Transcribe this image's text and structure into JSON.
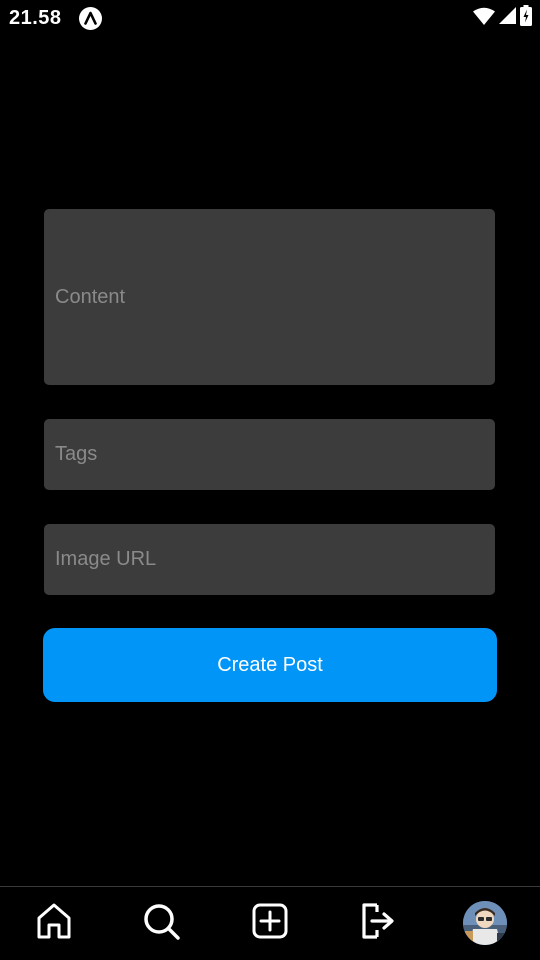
{
  "status_bar": {
    "time": "21.58",
    "app_icon": "app-notification-icon",
    "icons": [
      "wifi-icon",
      "cell-signal-icon",
      "battery-icon"
    ]
  },
  "form": {
    "content_placeholder": "Content",
    "content_value": "",
    "tags_placeholder": "Tags",
    "tags_value": "",
    "image_url_placeholder": "Image URL",
    "image_url_value": "",
    "submit_label": "Create Post"
  },
  "bottom_nav": {
    "items": [
      {
        "icon": "home-icon"
      },
      {
        "icon": "search-icon"
      },
      {
        "icon": "add-post-icon"
      },
      {
        "icon": "logout-icon"
      },
      {
        "icon": "profile-avatar"
      }
    ]
  },
  "colors": {
    "background": "#000000",
    "field_background": "#3c3c3c",
    "placeholder": "#8a8a8a",
    "accent": "#0195f7",
    "text": "#ffffff"
  }
}
